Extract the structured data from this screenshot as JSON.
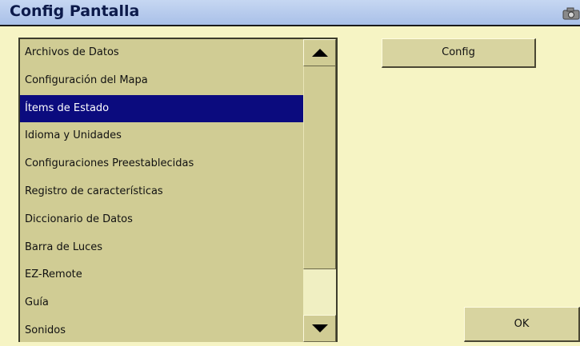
{
  "window": {
    "title": "Config Pantalla"
  },
  "list": {
    "items": [
      {
        "label": "Archivos de Datos",
        "selected": false
      },
      {
        "label": "Configuración del Mapa",
        "selected": false
      },
      {
        "label": "Ítems de Estado",
        "selected": true
      },
      {
        "label": "Idioma y Unidades",
        "selected": false
      },
      {
        "label": "Configuraciones Preestablecidas",
        "selected": false
      },
      {
        "label": "Registro de características",
        "selected": false
      },
      {
        "label": "Diccionario de Datos",
        "selected": false
      },
      {
        "label": "Barra de Luces",
        "selected": false
      },
      {
        "label": "EZ-Remote",
        "selected": false
      },
      {
        "label": "Guía",
        "selected": false
      },
      {
        "label": "Sonidos",
        "selected": false
      }
    ]
  },
  "buttons": {
    "config_label": "Config",
    "ok_label": "OK"
  },
  "icons": {
    "titlebar": "camera-icon",
    "scroll_up": "arrow-up-icon",
    "scroll_down": "arrow-down-icon"
  },
  "colors": {
    "selection": "#0b0b7e",
    "background": "#f6f4c4",
    "list_bg": "#d0cc94"
  }
}
